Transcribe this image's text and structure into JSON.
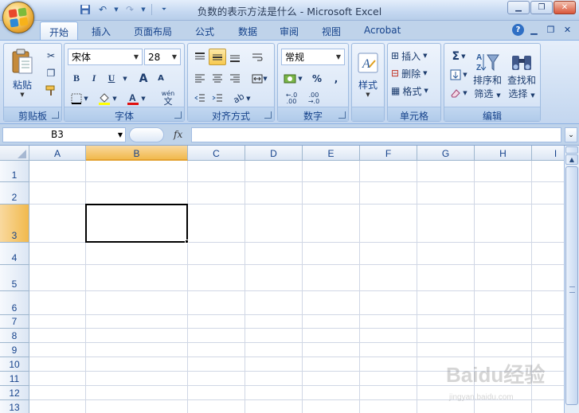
{
  "window": {
    "title": "负数的表示方法是什么 - Microsoft Excel",
    "controls": {
      "minimize": "minimize-icon",
      "restore": "restore-icon",
      "close": "close-icon"
    }
  },
  "quick_access": [
    "save-icon",
    "undo-icon",
    "redo-icon",
    "customize-icon"
  ],
  "tabs": [
    {
      "label": "开始",
      "active": true
    },
    {
      "label": "插入"
    },
    {
      "label": "页面布局"
    },
    {
      "label": "公式"
    },
    {
      "label": "数据"
    },
    {
      "label": "审阅"
    },
    {
      "label": "视图"
    },
    {
      "label": "Acrobat"
    }
  ],
  "ribbon": {
    "clipboard": {
      "label": "剪贴板",
      "paste": "粘贴"
    },
    "font": {
      "label": "字体",
      "font_name": "宋体",
      "font_size": "28",
      "bold": "B",
      "italic": "I",
      "underline": "U",
      "grow": "A",
      "shrink": "A",
      "phonetic_top": "wén",
      "phonetic_bottom": "文"
    },
    "alignment": {
      "label": "对齐方式"
    },
    "number": {
      "label": "数字",
      "format": "常规",
      "percent": "%",
      "comma": ",",
      "inc_decimal": "+.0 .00",
      "dec_decimal": ".00 →.0"
    },
    "styles": {
      "label": "样式"
    },
    "cells": {
      "label": "单元格",
      "insert": "插入",
      "delete": "删除",
      "format": "格式"
    },
    "editing": {
      "label": "编辑",
      "sort": "排序和",
      "sort2": "筛选",
      "find": "查找和",
      "find2": "选择",
      "sigma": "Σ"
    }
  },
  "formula_bar": {
    "name_box": "B3",
    "fx": "fx",
    "formula": ""
  },
  "sheet": {
    "columns": [
      "A",
      "B",
      "C",
      "D",
      "E",
      "F",
      "G",
      "H",
      "I"
    ],
    "rows": [
      "1",
      "2",
      "3",
      "4",
      "5",
      "6",
      "7",
      "8",
      "9",
      "10",
      "11",
      "12",
      "13"
    ],
    "selected_cell": "B3",
    "selected_column": "B",
    "selected_row": "3"
  },
  "watermark": {
    "text": "Baidu经验",
    "subtext": "jingyan.baidu.com"
  },
  "colors": {
    "accent": "#15428b",
    "selection_header": "#f1b94d",
    "ribbon_bg": "#d2e1f4"
  }
}
